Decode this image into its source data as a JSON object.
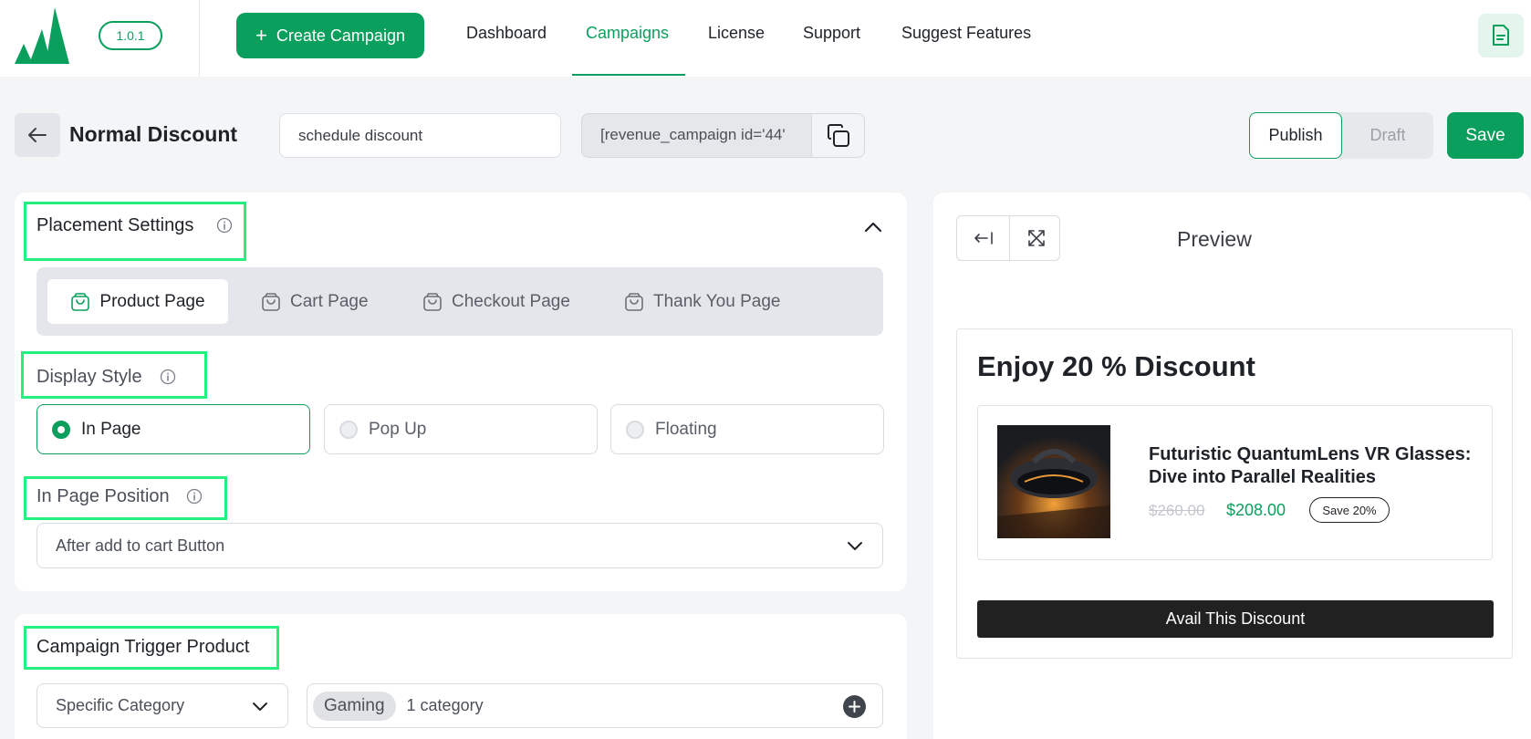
{
  "topnav": {
    "version": "1.0.1",
    "create_label": "Create Campaign",
    "links": [
      "Dashboard",
      "Campaigns",
      "License",
      "Support",
      "Suggest Features"
    ],
    "active_link": "Campaigns"
  },
  "header": {
    "title": "Normal Discount",
    "campaign_name": "schedule discount",
    "shortcode": "[revenue_campaign id='44'",
    "publish_label": "Publish",
    "draft_label": "Draft",
    "save_label": "Save"
  },
  "placement": {
    "title": "Placement Settings",
    "tabs": [
      {
        "label": "Product Page",
        "active": true
      },
      {
        "label": "Cart Page",
        "active": false
      },
      {
        "label": "Checkout Page",
        "active": false
      },
      {
        "label": "Thank You Page",
        "active": false
      }
    ]
  },
  "display_style": {
    "title": "Display Style",
    "options": [
      {
        "label": "In Page",
        "selected": true
      },
      {
        "label": "Pop Up",
        "selected": false
      },
      {
        "label": "Floating",
        "selected": false
      }
    ]
  },
  "in_page_position": {
    "title": "In Page Position",
    "value": "After add to cart Button"
  },
  "trigger": {
    "title": "Campaign Trigger Product",
    "type_value": "Specific Category",
    "chip": "Gaming",
    "count_text": "1 category"
  },
  "preview": {
    "title": "Preview",
    "heading": "Enjoy 20 % Discount",
    "product_name": "Futuristic QuantumLens VR Glasses: Dive into Parallel Realities",
    "price_old": "$260.00",
    "price_new": "$208.00",
    "save_badge": "Save 20%",
    "button_label": "Avail This Discount"
  },
  "colors": {
    "accent": "#0a9f5c",
    "highlight": "#22f07f",
    "dark_button": "#212121"
  }
}
